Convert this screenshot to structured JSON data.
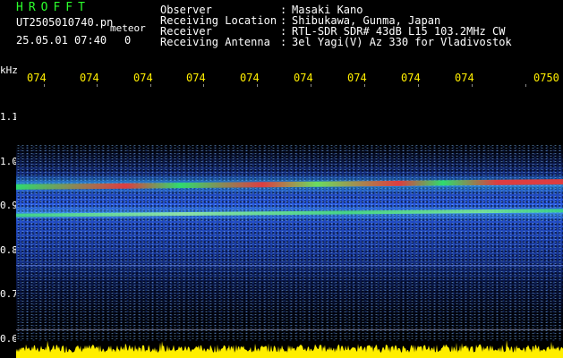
{
  "header": {
    "app_title": "HROFFT",
    "file_name": "UT2505010740.pn",
    "meteor_label": "meteor",
    "date_time": "25.05.01 07:40",
    "meteor_count": "0",
    "info": [
      {
        "label": "Observer",
        "sep": ":",
        "value": "Masaki Kano"
      },
      {
        "label": "Receiving Location",
        "sep": ":",
        "value": "Shibukawa, Gunma, Japan"
      },
      {
        "label": "Receiver",
        "sep": ":",
        "value": "RTL-SDR SDR# 43dB L15 103.2MHz CW"
      },
      {
        "label": "Receiving Antenna",
        "sep": ":",
        "value": "3el Yagi(V) Az 330 for Vladivostok"
      }
    ]
  },
  "axes": {
    "y_unit": "kHz",
    "y_ticks": [
      "1.1",
      "1.0",
      "0.9",
      "0.8",
      "0.7",
      "0.6"
    ],
    "x_ticks": [
      "074",
      "074",
      "074",
      "074",
      "074",
      "074",
      "074",
      "074",
      "074",
      "0750"
    ]
  },
  "colors": {
    "title": "#2cff2c",
    "text": "#ffffff",
    "time_ticks": "#ffee00",
    "noise": "#2850e0",
    "signal_red": "#e53a3a",
    "signal_green": "#2fe06a",
    "baseline": "#ffee00"
  },
  "chart_data": {
    "type": "heatmap",
    "ylim": [
      0.6,
      1.1
    ],
    "ylabel": "kHz",
    "signals": [
      {
        "freq_khz": 0.945,
        "strength": "strong"
      },
      {
        "freq_khz": 0.88,
        "strength": "medium"
      }
    ]
  }
}
